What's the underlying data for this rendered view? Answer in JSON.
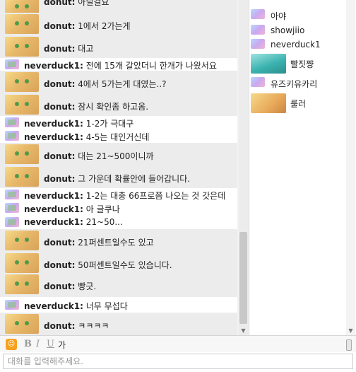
{
  "chat": {
    "messages": [
      {
        "nick": "donut:",
        "text": "아닐걸요",
        "kind": "donut"
      },
      {
        "nick": "donut:",
        "text": "1에서 2가는게",
        "kind": "donut"
      },
      {
        "nick": "donut:",
        "text": "대고",
        "kind": "donut"
      },
      {
        "nick": "neverduck1:",
        "text": "전에 15개 갈았더니 한개가 나왔서요",
        "kind": "never"
      },
      {
        "nick": "donut:",
        "text": "4에서 5가는게 대였는..?",
        "kind": "donut"
      },
      {
        "nick": "donut:",
        "text": "잠시 확인좀 하고옴.",
        "kind": "donut"
      },
      {
        "nick": "neverduck1:",
        "text": "1-2가 극대구",
        "kind": "never"
      },
      {
        "nick": "neverduck1:",
        "text": "4-5는 대인거신데",
        "kind": "never"
      },
      {
        "nick": "donut:",
        "text": "대는 21~500이니까",
        "kind": "donut"
      },
      {
        "nick": "donut:",
        "text": "그 가운데 확률안에 들어갑니다.",
        "kind": "donut"
      },
      {
        "nick": "neverduck1:",
        "text": "1-2는 대충 66프로쯤 나오는 것 갓은데",
        "kind": "never"
      },
      {
        "nick": "neverduck1:",
        "text": "아 글쿠나",
        "kind": "never"
      },
      {
        "nick": "neverduck1:",
        "text": "21~50...",
        "kind": "never"
      },
      {
        "nick": "donut:",
        "text": "21퍼센트일수도 있고",
        "kind": "donut"
      },
      {
        "nick": "donut:",
        "text": "50퍼센트일수도 있습니다.",
        "kind": "donut"
      },
      {
        "nick": "donut:",
        "text": "빵긋.",
        "kind": "donut"
      },
      {
        "nick": "neverduck1:",
        "text": "너무 무섭다",
        "kind": "never"
      },
      {
        "nick": "donut:",
        "text": "ㅋㅋㅋㅋ",
        "kind": "donut"
      }
    ]
  },
  "users": [
    {
      "name": "아야",
      "avatar": "generic"
    },
    {
      "name": "showjiio",
      "avatar": "generic"
    },
    {
      "name": "neverduck1",
      "avatar": "generic"
    },
    {
      "name": "빨짓쨩",
      "avatar": "miku"
    },
    {
      "name": "유즈키유카리",
      "avatar": "generic"
    },
    {
      "name": "룰러",
      "avatar": "anime"
    }
  ],
  "toolbar": {
    "emoticon_icon": "emoticon-icon",
    "bold_label": "B",
    "italic_label": "I",
    "underline_label": "U",
    "font_color_label": "가"
  },
  "input": {
    "placeholder": "대화를 입력해주세요."
  },
  "colors": {
    "emoticon": "#f6a21e",
    "row_alt": "#ffffff",
    "row_reg": "#ececec"
  }
}
